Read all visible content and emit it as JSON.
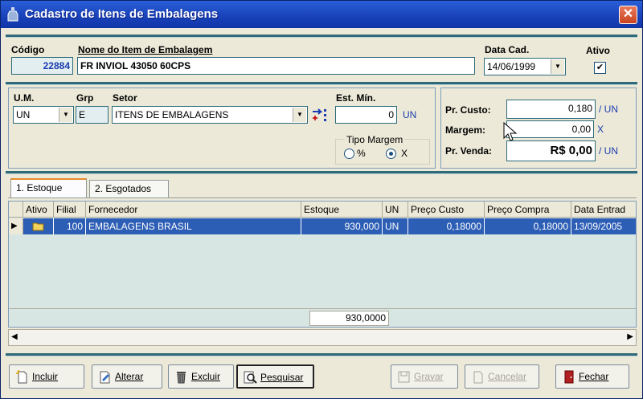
{
  "window": {
    "title": "Cadastro de Itens de Embalagens",
    "close_glyph": "✕"
  },
  "header": {
    "codigo_label": "Código",
    "codigo_value": "22884",
    "nome_label": "Nome do Item de Embalagem",
    "nome_value": "FR INVIOL 43050  60CPS",
    "data_label": "Data Cad.",
    "data_value": "14/06/1999",
    "ativo_label": "Ativo",
    "ativo_checked": "✔"
  },
  "details": {
    "um_label": "U.M.",
    "um_value": "UN",
    "grp_label": "Grp",
    "grp_value": "E",
    "setor_label": "Setor",
    "setor_value": "ITENS DE EMBALAGENS",
    "estmin_label": "Est. Mín.",
    "estmin_value": "0",
    "estmin_unit": "UN",
    "tipo_margem_label": "Tipo Margem",
    "tipo_pct": "%",
    "tipo_x": "X"
  },
  "pricing": {
    "custo_label": "Pr. Custo:",
    "custo_value": "0,180",
    "custo_unit": "/ UN",
    "margem_label": "Margem:",
    "margem_value": "0,00",
    "margem_unit": "X",
    "venda_label": "Pr. Venda:",
    "venda_value": "R$  0,00",
    "venda_unit": "/ UN"
  },
  "tabs": [
    {
      "label": "1. Estoque"
    },
    {
      "label": "2. Esgotados"
    }
  ],
  "grid": {
    "columns": [
      "Ativo",
      "Filial",
      "Fornecedor",
      "Estoque",
      "UN",
      "Preço Custo",
      "Preço Compra",
      "Data Entrad"
    ],
    "rows": [
      {
        "indicator": "▶",
        "filial": "100",
        "fornecedor": "EMBALAGENS BRASIL",
        "estoque": "930,000",
        "un": "UN",
        "preco_custo": "0,18000",
        "preco_compra": "0,18000",
        "data_entrada": "13/09/2005"
      }
    ],
    "total_estoque": "930,0000"
  },
  "buttons": {
    "incluir": "Incluir",
    "alterar": "Alterar",
    "excluir": "Excluir",
    "pesquisar": "Pesquisar",
    "gravar": "Gravar",
    "cancelar": "Cancelar",
    "fechar": "Fechar"
  },
  "colors": {
    "title_blue": "#1941b8",
    "accent_teal": "#2e6a7a",
    "selection_blue": "#2d5eb5",
    "link_blue": "#1a3cb0"
  }
}
